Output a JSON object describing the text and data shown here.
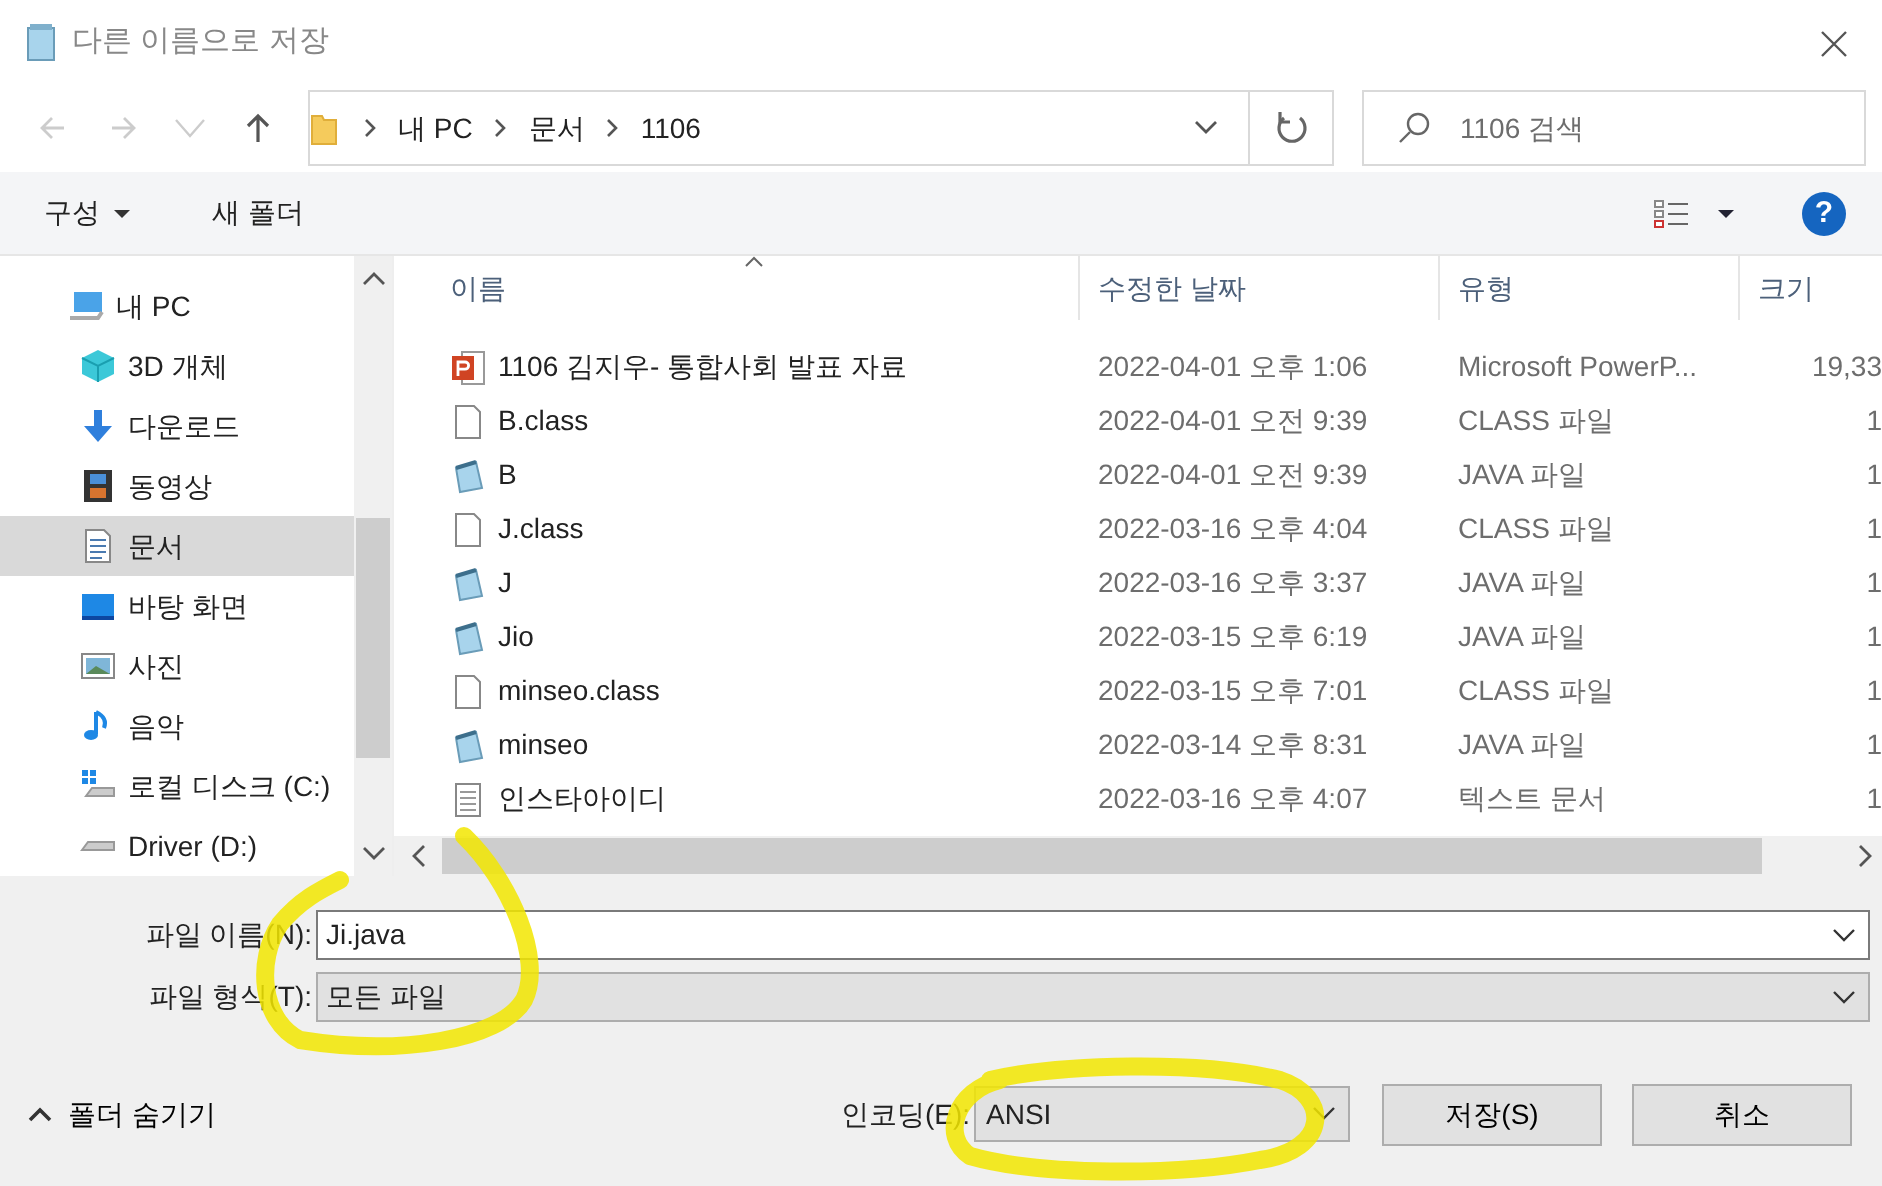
{
  "window": {
    "title": "다른 이름으로 저장"
  },
  "address": {
    "breadcrumb": [
      "내 PC",
      "문서",
      "1106"
    ],
    "search_placeholder": "1106 검색"
  },
  "toolbar": {
    "organize": "구성",
    "new_folder": "새 폴더",
    "help": "?"
  },
  "sidebar": {
    "items": [
      {
        "label": "내 PC",
        "kind": "pc",
        "selected": false,
        "children": [
          {
            "label": "3D 개체",
            "kind": "cube",
            "selected": false
          },
          {
            "label": "다운로드",
            "kind": "download",
            "selected": false
          },
          {
            "label": "동영상",
            "kind": "film",
            "selected": false
          },
          {
            "label": "문서",
            "kind": "document",
            "selected": true
          },
          {
            "label": "바탕 화면",
            "kind": "desktop",
            "selected": false
          },
          {
            "label": "사진",
            "kind": "picture",
            "selected": false
          },
          {
            "label": "음악",
            "kind": "music",
            "selected": false
          },
          {
            "label": "로컬 디스크 (C:)",
            "kind": "system-drive",
            "selected": false
          },
          {
            "label": "Driver (D:)",
            "kind": "drive",
            "selected": false
          }
        ]
      }
    ]
  },
  "table": {
    "columns": [
      {
        "label": "이름",
        "sorted": true
      },
      {
        "label": "수정한 날짜",
        "sorted": false
      },
      {
        "label": "유형",
        "sorted": false
      },
      {
        "label": "크기",
        "sorted": false
      }
    ],
    "rows": [
      {
        "name": "1106 김지우- 통합사회 발표 자료",
        "kind": "slides",
        "date": "2022-04-01 오후 1:06",
        "type": "Microsoft PowerP...",
        "size": "19,33"
      },
      {
        "name": "B.class",
        "kind": "blank",
        "date": "2022-04-01 오전 9:39",
        "type": "CLASS 파일",
        "size": "1"
      },
      {
        "name": "B",
        "kind": "notepad",
        "date": "2022-04-01 오전 9:39",
        "type": "JAVA 파일",
        "size": "1"
      },
      {
        "name": "J.class",
        "kind": "blank",
        "date": "2022-03-16 오후 4:04",
        "type": "CLASS 파일",
        "size": "1"
      },
      {
        "name": "J",
        "kind": "notepad",
        "date": "2022-03-16 오후 3:37",
        "type": "JAVA 파일",
        "size": "1"
      },
      {
        "name": "Jio",
        "kind": "notepad",
        "date": "2022-03-15 오후 6:19",
        "type": "JAVA 파일",
        "size": "1"
      },
      {
        "name": "minseo.class",
        "kind": "blank",
        "date": "2022-03-15 오후 7:01",
        "type": "CLASS 파일",
        "size": "1"
      },
      {
        "name": "minseo",
        "kind": "notepad",
        "date": "2022-03-14 오후 8:31",
        "type": "JAVA 파일",
        "size": "1"
      },
      {
        "name": "인스타아이디",
        "kind": "text",
        "date": "2022-03-16 오후 4:07",
        "type": "텍스트 문서",
        "size": "1"
      }
    ]
  },
  "form": {
    "file_name": {
      "label": "파일 이름(N):",
      "value": "Ji.java"
    },
    "file_type": {
      "label": "파일 형식(T):",
      "value": "모든 파일"
    }
  },
  "footer": {
    "hide_folders": "폴더 숨기기",
    "encoding": {
      "label": "인코딩(E):",
      "value": "ANSI"
    },
    "buttons": [
      "저장(S)",
      "취소"
    ]
  }
}
